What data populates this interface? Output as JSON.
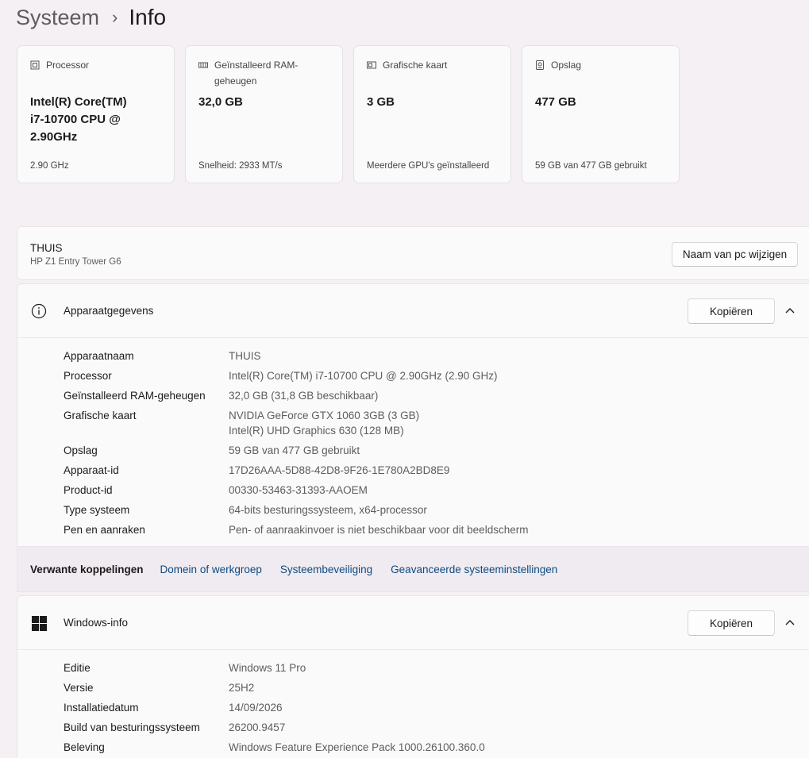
{
  "breadcrumb": {
    "parent": "Systeem",
    "separator": "›",
    "current": "Info"
  },
  "cards": [
    {
      "icon": "processor-icon",
      "title": "Processor",
      "value": "Intel(R) Core(TM) i7-10700 CPU @ 2.90GHz",
      "sub": "2.90 GHz"
    },
    {
      "icon": "ram-icon",
      "title": "Geïnstalleerd RAM-geheugen",
      "value": "32,0 GB",
      "sub": "Snelheid: 2933 MT/s"
    },
    {
      "icon": "graphics-card-icon",
      "title": "Grafische kaart",
      "value": "3 GB",
      "sub": "Meerdere GPU's geïnstalleerd"
    },
    {
      "icon": "storage-icon",
      "title": "Opslag",
      "value": "477 GB",
      "sub": "59 GB van 477 GB gebruikt"
    }
  ],
  "pc": {
    "name": "THUIS",
    "model": "HP Z1 Entry Tower G6",
    "rename_label": "Naam van pc wijzigen"
  },
  "device_specs": {
    "title": "Apparaatgegevens",
    "copy_label": "Kopiëren",
    "rows": [
      {
        "label": "Apparaatnaam",
        "value": "THUIS"
      },
      {
        "label": "Processor",
        "value": "Intel(R) Core(TM) i7-10700 CPU @ 2.90GHz (2.90 GHz)"
      },
      {
        "label": "Geïnstalleerd RAM-geheugen",
        "value": "32,0 GB (31,8 GB beschikbaar)"
      },
      {
        "label": "Grafische kaart",
        "value": "NVIDIA GeForce GTX 1060 3GB (3 GB)",
        "value2": "Intel(R) UHD Graphics 630 (128 MB)"
      },
      {
        "label": "Opslag",
        "value": "59 GB van 477 GB gebruikt"
      },
      {
        "label": "Apparaat-id",
        "value": "17D26AAA-5D88-42D8-9F26-1E780A2BD8E9"
      },
      {
        "label": "Product-id",
        "value": "00330-53463-31393-AAOEM"
      },
      {
        "label": "Type systeem",
        "value": "64-bits besturingssysteem, x64-processor"
      },
      {
        "label": "Pen en aanraken",
        "value": "Pen- of aanraakinvoer is niet beschikbaar voor dit beeldscherm"
      }
    ]
  },
  "related": {
    "label": "Verwante koppelingen",
    "links": [
      "Domein of werkgroep",
      "Systeembeveiliging",
      "Geavanceerde systeeminstellingen"
    ]
  },
  "windows_specs": {
    "title": "Windows-info",
    "copy_label": "Kopiëren",
    "rows": [
      {
        "label": "Editie",
        "value": "Windows 11 Pro"
      },
      {
        "label": "Versie",
        "value": "25H2"
      },
      {
        "label": "Installatiedatum",
        "value": "14/09/2026"
      },
      {
        "label": "Build van besturingssysteem",
        "value": "26200.9457"
      },
      {
        "label": "Beleving",
        "value": "Windows Feature Experience Pack 1000.26100.360.0"
      }
    ]
  },
  "colors": {
    "link": "#0d4a80",
    "background": "#f5f0f4",
    "card": "#fbfafb"
  }
}
